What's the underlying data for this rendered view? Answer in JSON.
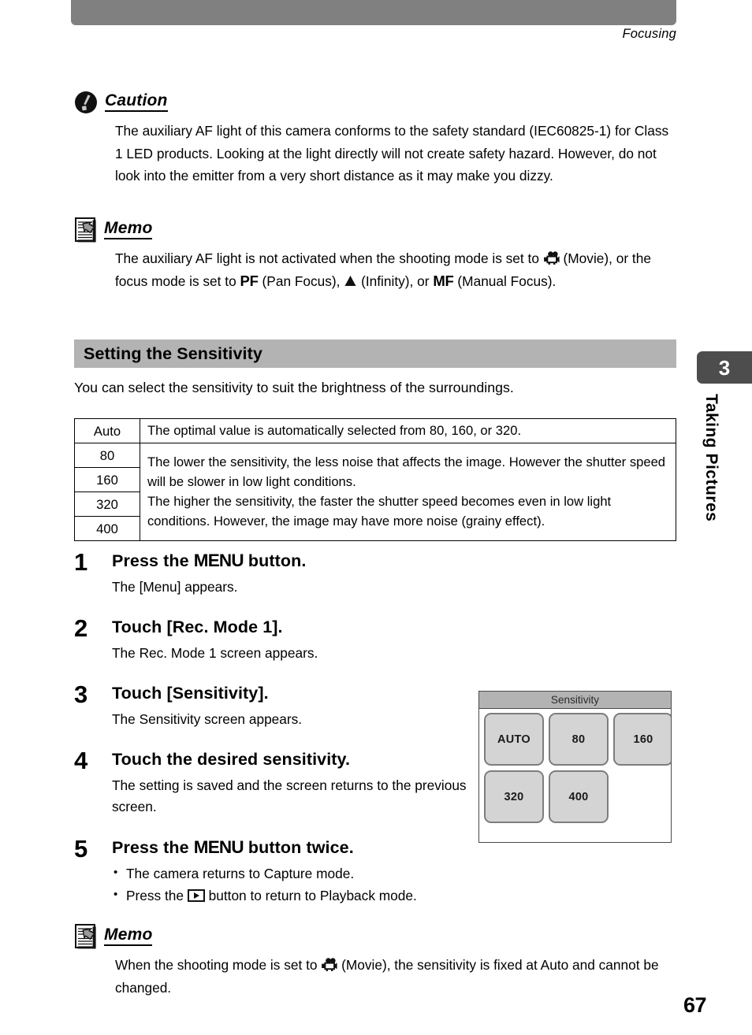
{
  "running_head": "Focusing",
  "caution": {
    "icon": "caution-exclamation-icon",
    "title": "Caution",
    "body": "The auxiliary AF light of this camera conforms to the safety standard (IEC60825-1) for Class 1 LED products. Looking at the light directly will not create safety hazard. However, do not look into the emitter from a very short distance as it may make you dizzy."
  },
  "memo_top": {
    "icon": "memo-note-icon",
    "title": "Memo",
    "text_1": "The auxiliary AF light is not activated when the shooting mode is set to ",
    "icon_movie": "movie-camera-icon",
    "text_2": " (Movie), or the focus mode is set to ",
    "key_pf": "PF",
    "text_3": " (Pan Focus), ",
    "icon_infinity": "infinity-mountain-icon",
    "text_4": " (Infinity), or ",
    "key_mf": "MF",
    "text_5": " (Manual Focus)."
  },
  "section": {
    "title": "Setting the Sensitivity",
    "intro": "You can select the sensitivity to suit the brightness of the surroundings."
  },
  "table": {
    "rows": [
      {
        "key": "Auto",
        "value": "The optimal value is automatically selected from 80, 160, or 320."
      },
      {
        "key": "80"
      },
      {
        "key": "160"
      },
      {
        "key": "320"
      },
      {
        "key": "400"
      }
    ],
    "merged_value": "The lower the sensitivity, the less noise that affects the image. However the shutter speed will be slower in low light conditions. The higher the sensitivity, the faster the shutter speed becomes even in low light conditions. However, the image may have more noise (grainy effect).",
    "merged_value_line_1": "The lower the sensitivity, the less noise that affects the image. However the shutter speed will be slower in low light conditions.",
    "merged_value_line_2": "The higher the sensitivity, the faster the shutter speed becomes even in low light conditions. However, the image may have more noise (grainy effect)."
  },
  "steps": [
    {
      "number": "1",
      "title_before": "Press the ",
      "key": "MENU",
      "title_after": " button.",
      "desc": "The [Menu] appears."
    },
    {
      "number": "2",
      "title_before": "Touch [Rec. Mode 1].",
      "key": "",
      "title_after": "",
      "desc": "The Rec. Mode 1 screen appears."
    },
    {
      "number": "3",
      "title_before": "Touch [Sensitivity].",
      "key": "",
      "title_after": "",
      "desc": "The Sensitivity screen appears."
    },
    {
      "number": "4",
      "title_before": "Touch the desired sensitivity.",
      "key": "",
      "title_after": "",
      "desc": "The setting is saved and the screen returns to the previous screen."
    },
    {
      "number": "5",
      "title_before": "Press the ",
      "key": "MENU",
      "title_after": " button twice.",
      "bullet_1": "The camera returns to Capture mode.",
      "bullet_2_before": "Press the ",
      "bullet_2_icon": "playback-button-icon",
      "bullet_2_after": " button to return to Playback mode."
    }
  ],
  "lcd_screen": {
    "title": "Sensitivity",
    "buttons": [
      "AUTO",
      "80",
      "160",
      "320",
      "400"
    ]
  },
  "memo_bottom": {
    "icon": "memo-note-icon",
    "title": "Memo",
    "text_1": "When the shooting mode is set to ",
    "icon_movie": "movie-camera-icon",
    "text_2": " (Movie), the sensitivity is fixed at Auto and cannot be changed."
  },
  "chapter": {
    "number": "3",
    "label": "Taking Pictures"
  },
  "page_number": "67",
  "colors": {
    "top_band": "#808080",
    "section_bar": "#b3b3b3",
    "chapter_tab": "#4d4d4d",
    "lcd_button_fill": "#d4d4d4",
    "lcd_button_border": "#7d7d7d"
  }
}
